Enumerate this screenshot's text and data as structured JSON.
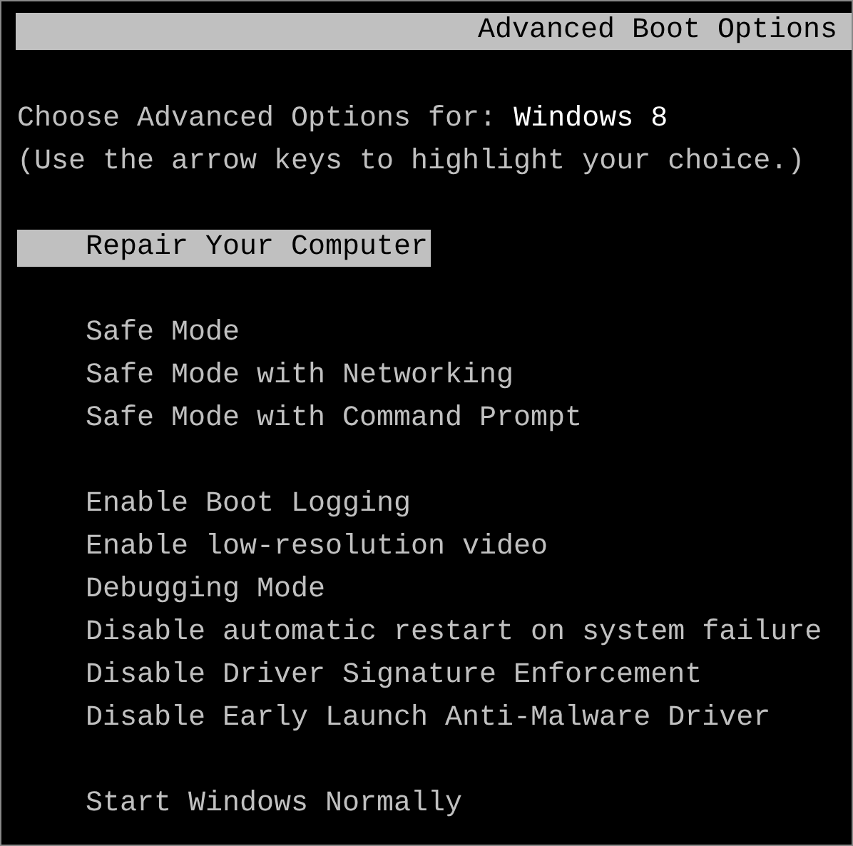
{
  "title": "Advanced Boot Options",
  "prompt": {
    "label": "Choose Advanced Options for:",
    "os": "Windows 8"
  },
  "hint": "(Use the arrow keys to highlight your choice.)",
  "groups": [
    {
      "items": [
        {
          "label": "Repair Your Computer",
          "selected": true
        }
      ]
    },
    {
      "items": [
        {
          "label": "Safe Mode",
          "selected": false
        },
        {
          "label": "Safe Mode with Networking",
          "selected": false
        },
        {
          "label": "Safe Mode with Command Prompt",
          "selected": false
        }
      ]
    },
    {
      "items": [
        {
          "label": "Enable Boot Logging",
          "selected": false
        },
        {
          "label": "Enable low-resolution video",
          "selected": false
        },
        {
          "label": "Debugging Mode",
          "selected": false
        },
        {
          "label": "Disable automatic restart on system failure",
          "selected": false
        },
        {
          "label": "Disable Driver Signature Enforcement",
          "selected": false
        },
        {
          "label": "Disable Early Launch Anti-Malware Driver",
          "selected": false
        }
      ]
    },
    {
      "items": [
        {
          "label": "Start Windows Normally",
          "selected": false
        }
      ]
    }
  ]
}
